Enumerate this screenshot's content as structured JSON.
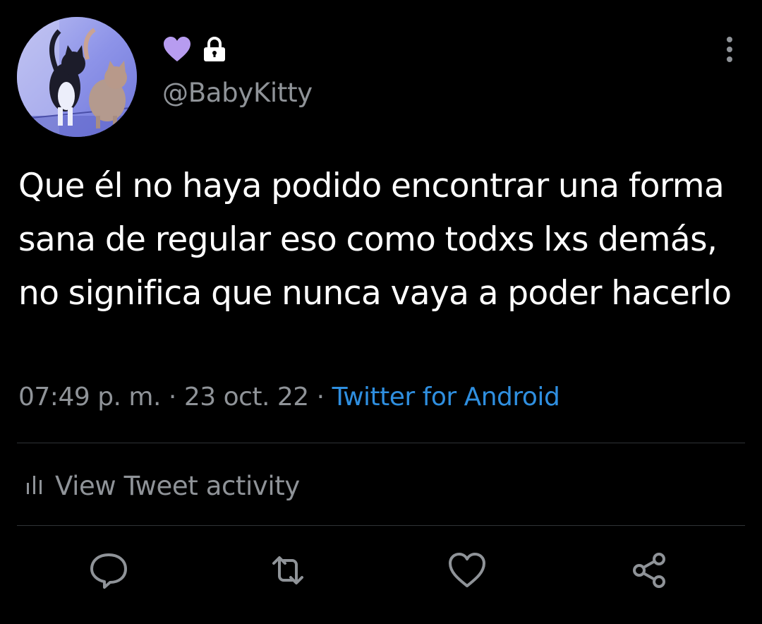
{
  "author": {
    "handle": "@BabyKitty",
    "avatar_icon": "cat-avatar",
    "badges": [
      "purple-heart-icon",
      "lock-icon"
    ],
    "heart_color": "#b79cf0"
  },
  "tweet": {
    "text": "Que él no haya podido encontrar una forma sana de regular eso como todxs lxs demás, no significa que nunca vaya a poder hacerlo",
    "time": "07:49 p. m.",
    "separator": "·",
    "date": "23 oct. 22",
    "source": "Twitter for Android"
  },
  "activity": {
    "label": "View Tweet activity",
    "icon": "bar-chart-icon"
  },
  "actions": [
    "reply-icon",
    "retweet-icon",
    "like-icon",
    "share-icon"
  ],
  "colors": {
    "background": "#000000",
    "text": "#ffffff",
    "secondary": "#8f9398",
    "link": "#2f8fe0",
    "divider": "#2f3336"
  }
}
